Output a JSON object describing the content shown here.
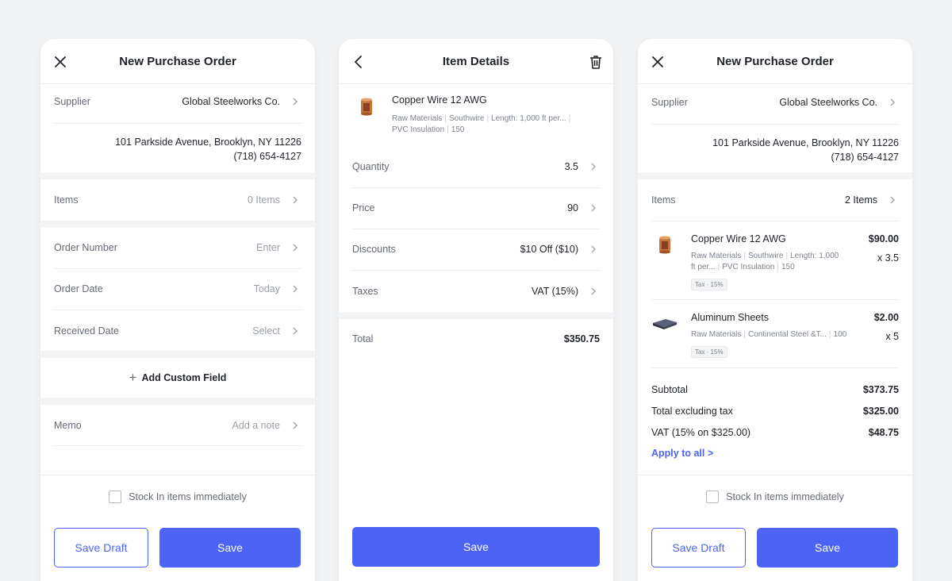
{
  "po_form": {
    "title": "New Purchase Order",
    "supplier_label": "Supplier",
    "supplier_value": "Global Steelworks Co.",
    "address_line1": "101 Parkside Avenue, Brooklyn, NY 11226",
    "address_line2": "(718) 654-4127",
    "items_label": "Items",
    "items_value": "0 Items",
    "order_number_label": "Order Number",
    "order_number_value": "Enter",
    "order_date_label": "Order Date",
    "order_date_value": "Today",
    "received_date_label": "Received Date",
    "received_date_value": "Select",
    "add_custom_field": "Add Custom Field",
    "memo_label": "Memo",
    "memo_value": "Add a note",
    "stock_in_label": "Stock In items immediately",
    "save_draft_label": "Save Draft",
    "save_label": "Save"
  },
  "item_details": {
    "title": "Item Details",
    "item_name": "Copper Wire 12 AWG",
    "meta_category": "Raw Materials",
    "meta_supplier": "Southwire",
    "meta_length": "Length: 1,000 ft per...",
    "meta_insulation": "PVC Insulation",
    "meta_stock": "150",
    "quantity_label": "Quantity",
    "quantity_value": "3.5",
    "price_label": "Price",
    "price_value": "90",
    "discounts_label": "Discounts",
    "discounts_value": "$10 Off ($10)",
    "taxes_label": "Taxes",
    "taxes_value": "VAT (15%)",
    "total_label": "Total",
    "total_value": "$350.75",
    "save_label": "Save"
  },
  "po_filled": {
    "title": "New Purchase Order",
    "supplier_label": "Supplier",
    "supplier_value": "Global Steelworks Co.",
    "address_line1": "101 Parkside Avenue, Brooklyn, NY 11226",
    "address_line2": "(718) 654-4127",
    "items_label": "Items",
    "items_value": "2 Items",
    "items": [
      {
        "name": "Copper Wire 12 AWG",
        "meta_line1_a": "Raw Materials",
        "meta_line1_b": "Southwire",
        "meta_line1_c": "Length: 1,000",
        "meta_line2_a": "ft per...",
        "meta_line2_b": "PVC Insulation",
        "meta_line2_c": "150",
        "tax": "Tax · 15%",
        "price": "$90.00",
        "qty": "x 3.5"
      },
      {
        "name": "Aluminum Sheets",
        "meta_line1_a": "Raw Materials",
        "meta_line1_b": "Continental Steel &T...",
        "meta_line1_c": "100",
        "tax": "Tax · 15%",
        "price": "$2.00",
        "qty": "x 5"
      }
    ],
    "subtotal_label": "Subtotal",
    "subtotal_value": "$373.75",
    "excl_tax_label": "Total excluding tax",
    "excl_tax_value": "$325.00",
    "vat_label": "VAT (15% on $325.00)",
    "vat_value": "$48.75",
    "apply_to_all": "Apply to all >",
    "stock_in_label": "Stock In items immediately",
    "save_draft_label": "Save Draft",
    "save_label": "Save"
  },
  "icons": {
    "close": "close-icon",
    "back": "chevron-left-icon",
    "delete": "trash-icon",
    "chevron": "chevron-right-icon",
    "add": "plus-icon"
  },
  "colors": {
    "accent": "#4c64f5",
    "background": "#f1f2f4"
  }
}
